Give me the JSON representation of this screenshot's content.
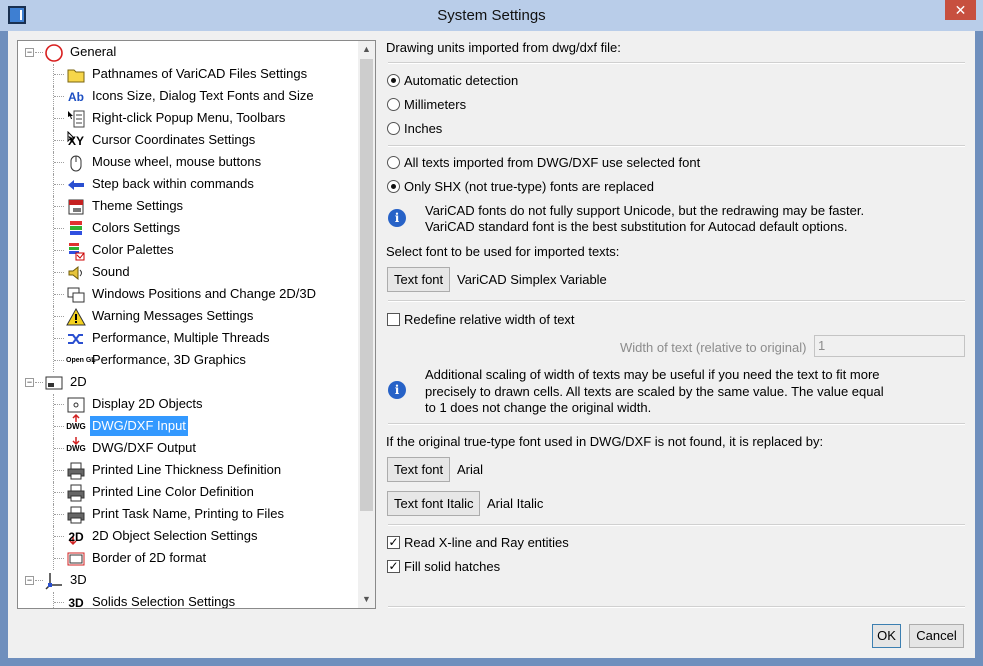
{
  "window": {
    "title": "System Settings",
    "close_glyph": "✕"
  },
  "tree": {
    "items": [
      {
        "label": "General",
        "icon": "general-circle-icon",
        "level": 0,
        "expander": "−"
      },
      {
        "label": "Pathnames of VariCAD Files Settings",
        "icon": "folder-icon",
        "level": 1
      },
      {
        "label": "Icons Size, Dialog Text Fonts and Size",
        "icon": "ab-font-icon",
        "icon_text": "Ab",
        "level": 1
      },
      {
        "label": "Right-click Popup Menu, Toolbars",
        "icon": "popup-menu-icon",
        "level": 1
      },
      {
        "label": "Cursor Coordinates Settings",
        "icon": "cursor-xy-icon",
        "icon_text": "XY",
        "level": 1
      },
      {
        "label": "Mouse wheel, mouse buttons",
        "icon": "mouse-icon",
        "level": 1
      },
      {
        "label": "Step back within commands",
        "icon": "arrow-left-icon",
        "level": 1
      },
      {
        "label": "Theme Settings",
        "icon": "theme-icon",
        "level": 1
      },
      {
        "label": "Colors Settings",
        "icon": "colors-icon",
        "level": 1
      },
      {
        "label": "Color Palettes",
        "icon": "palette-icon",
        "level": 1
      },
      {
        "label": "Sound",
        "icon": "speaker-icon",
        "level": 1
      },
      {
        "label": "Windows Positions and Change 2D/3D",
        "icon": "windows-icon",
        "level": 1
      },
      {
        "label": "Warning Messages Settings",
        "icon": "warning-icon",
        "level": 1
      },
      {
        "label": "Performance, Multiple Threads",
        "icon": "threads-icon",
        "level": 1
      },
      {
        "label": "Performance, 3D Graphics",
        "icon": "opengl-icon",
        "icon_text": "Open GL",
        "level": 1
      },
      {
        "label": "2D",
        "icon": "2d-window-icon",
        "level": 0,
        "expander": "−"
      },
      {
        "label": "Display 2D Objects",
        "icon": "display-2d-icon",
        "level": 1
      },
      {
        "label": "DWG/DXF Input",
        "icon": "dwg-input-icon",
        "icon_text": "DWG",
        "level": 1,
        "selected": true
      },
      {
        "label": "DWG/DXF Output",
        "icon": "dwg-output-icon",
        "icon_text": "DWG",
        "level": 1
      },
      {
        "label": "Printed Line Thickness Definition",
        "icon": "printer-icon",
        "level": 1
      },
      {
        "label": "Printed Line Color Definition",
        "icon": "printer-icon",
        "level": 1
      },
      {
        "label": "Print Task Name, Printing to Files",
        "icon": "printer-icon",
        "level": 1
      },
      {
        "label": "2D Object Selection Settings",
        "icon": "2d-select-icon",
        "icon_text": "2D",
        "level": 1
      },
      {
        "label": "Border of 2D format",
        "icon": "border-icon",
        "level": 1
      },
      {
        "label": "3D",
        "icon": "3d-axes-icon",
        "level": 0,
        "expander": "−"
      },
      {
        "label": "Solids Selection Settings",
        "icon": "3d-select-icon",
        "icon_text": "3D",
        "level": 1
      }
    ]
  },
  "panel": {
    "units_heading": "Drawing units imported from dwg/dxf file:",
    "units_options": [
      {
        "label": "Automatic detection",
        "checked": true
      },
      {
        "label": "Millimeters",
        "checked": false
      },
      {
        "label": "Inches",
        "checked": false
      }
    ],
    "font_options": [
      {
        "label": "All texts imported from DWG/DXF use selected font",
        "checked": false
      },
      {
        "label": "Only SHX (not true-type) fonts are replaced",
        "checked": true
      }
    ],
    "info1": [
      "VariCAD fonts do not fully support Unicode, but the redrawing may be faster.",
      "VariCAD standard font is the best substitution for Autocad default options."
    ],
    "select_font_label": "Select font to be used for imported texts:",
    "text_font_button": "Text font",
    "selected_font": "VariCAD Simplex Variable",
    "redefine_width_label": "Redefine relative width of text",
    "redefine_width_checked": false,
    "width_label": "Width of text (relative to original)",
    "width_value": "1",
    "info2": [
      "Additional scaling of width of texts may be useful if you need the text to fit more",
      "precisely to drawn cells. All texts are scaled by the same value. The value equal",
      "to 1 does not change the original width."
    ],
    "truetype_heading": "If the original true-type font used in DWG/DXF is not found, it is replaced by:",
    "tt_font_button": "Text font",
    "tt_font_value": "Arial",
    "tt_italic_button": "Text font Italic",
    "tt_italic_value": "Arial Italic",
    "read_xline_label": "Read X-line and Ray entities",
    "read_xline_checked": true,
    "fill_hatches_label": "Fill solid hatches",
    "fill_hatches_checked": true,
    "check_glyph": "✓"
  },
  "footer": {
    "ok_label": "OK",
    "cancel_label": "Cancel"
  },
  "colors": {
    "titlebar": "#b9cde9",
    "frame": "#6f8fbd",
    "selection": "#3399ff",
    "close": "#c7503f",
    "info": "#2762c7"
  }
}
